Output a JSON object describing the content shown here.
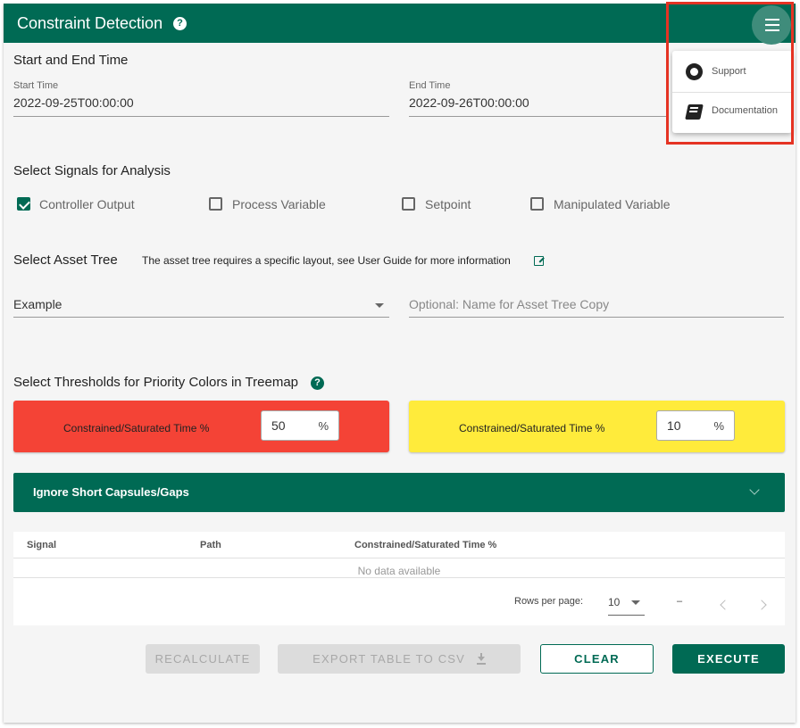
{
  "header": {
    "title": "Constraint Detection",
    "help_icon": "help-circle-icon",
    "menu_icon": "hamburger-menu-icon"
  },
  "time": {
    "section_title": "Start and End Time",
    "start_label": "Start Time",
    "start_value": "2022-09-25T00:00:00",
    "end_label": "End Time",
    "end_value": "2022-09-26T00:00:00"
  },
  "signals": {
    "section_title": "Select Signals for Analysis",
    "items": [
      {
        "label": "Controller Output",
        "checked": true
      },
      {
        "label": "Process Variable",
        "checked": false
      },
      {
        "label": "Setpoint",
        "checked": false
      },
      {
        "label": "Manipulated Variable",
        "checked": false
      }
    ]
  },
  "asset_tree": {
    "section_title": "Select Asset Tree",
    "note": "The asset tree requires a specific layout, see User Guide for more information",
    "selected": "Example",
    "copy_placeholder": "Optional: Name for Asset Tree Copy"
  },
  "thresholds": {
    "section_title": "Select Thresholds for Priority Colors in Treemap",
    "red": {
      "label": "Constrained/Saturated Time %",
      "value": "50",
      "unit": "%",
      "color": "#f44336"
    },
    "yellow": {
      "label": "Constrained/Saturated Time %",
      "value": "10",
      "unit": "%",
      "color": "#ffeb3b"
    }
  },
  "accordion": {
    "label": "Ignore Short Capsules/Gaps"
  },
  "table": {
    "headers": [
      "Signal",
      "Path",
      "Constrained/Saturated Time %"
    ],
    "empty_text": "No data available",
    "rows_per_page_label": "Rows per page:",
    "rows_per_page_value": "10",
    "range_text": "–"
  },
  "buttons": {
    "recalculate": "RECALCULATE",
    "export": "EXPORT TABLE TO CSV",
    "clear": "CLEAR",
    "execute": "EXECUTE"
  },
  "menu": {
    "items": [
      {
        "label": "Support",
        "icon": "github-icon"
      },
      {
        "label": "Documentation",
        "icon": "book-icon"
      }
    ]
  },
  "colors": {
    "brand": "#006a54",
    "highlight": "#e53323"
  }
}
